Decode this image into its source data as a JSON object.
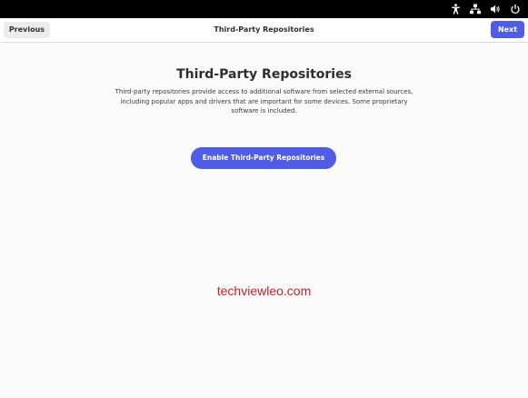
{
  "header": {
    "title": "Third-Party Repositories",
    "previous_label": "Previous",
    "next_label": "Next"
  },
  "tray": {
    "icons": [
      "accessibility-icon",
      "network-icon",
      "volume-icon",
      "power-icon"
    ]
  },
  "main": {
    "title": "Third-Party Repositories",
    "description": "Third-party repositories provide access to additional software from selected external sources, including popular apps and drivers that are important for some devices. Some proprietary software is included.",
    "enable_button_label": "Enable Third-Party Repositories"
  },
  "watermark": {
    "text": "techviewleo.com"
  },
  "colors": {
    "accent": "#4f5ce3",
    "topbar": "#000000",
    "watermark": "#cc1f2b"
  }
}
